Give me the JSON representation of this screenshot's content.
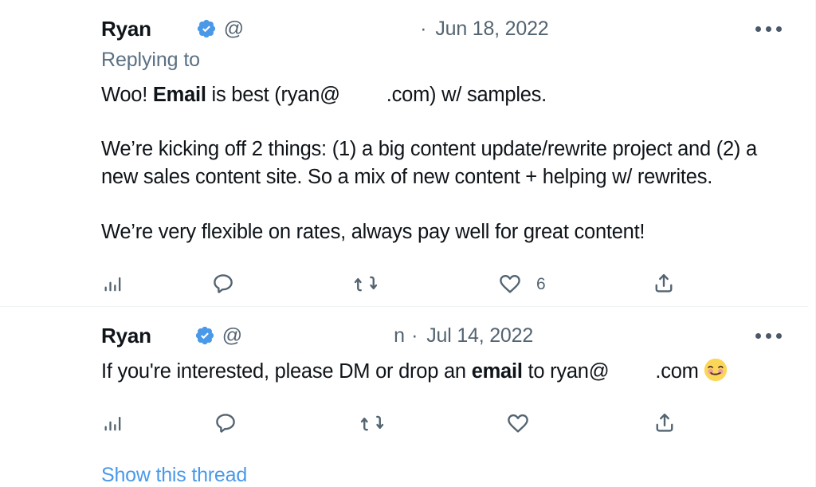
{
  "theme": {
    "background": "#ffffff",
    "text_primary": "#0f1419",
    "text_secondary": "#536471",
    "link": "#4a99e9",
    "verified_blue": "#4a99e9",
    "divider": "#eef3f4"
  },
  "tweets": [
    {
      "display_name": "Ryan",
      "verified_icon": "verified-badge-icon",
      "handle": "@",
      "separator": "·",
      "date": "Jun 18, 2022",
      "more_icon": "more-horizontal-icon",
      "replying_to": "Replying to",
      "body": {
        "line1_a": "Woo! ",
        "line1_bold": "Email",
        "line1_b": " is best (ryan@",
        "line1_c": ".com) w/ samples.",
        "para2": "We’re kicking off 2 things: (1) a big content update/rewrite project and (2) a new sales content site. So a mix of new content + helping w/ rewrites.",
        "para3": "We’re very flexible on rates, always pay well for great content!"
      },
      "actions": {
        "analytics": {
          "icon": "analytics-bar-icon",
          "label": "View Tweet analytics",
          "count": ""
        },
        "reply": {
          "icon": "reply-bubble-icon",
          "label": "Reply",
          "count": ""
        },
        "retweet": {
          "icon": "retweet-icon",
          "label": "Retweet",
          "count": ""
        },
        "like": {
          "icon": "heart-icon",
          "label": "Like",
          "count": "6"
        },
        "share": {
          "icon": "share-upload-icon",
          "label": "Share Tweet",
          "count": ""
        }
      }
    },
    {
      "display_name": "Ryan",
      "verified_icon": "verified-badge-icon",
      "handle": "@",
      "handle_tail": "n",
      "separator": "·",
      "date": "Jul 14, 2022",
      "more_icon": "more-horizontal-icon",
      "body": {
        "line1_a": "If you're interested, please DM or drop an ",
        "line1_bold": "email",
        "line1_b": " to ryan@",
        "line1_c": ".com",
        "emoji": "smiling-face-with-smiling-eyes"
      },
      "actions": {
        "analytics": {
          "icon": "analytics-bar-icon",
          "label": "View Tweet analytics",
          "count": ""
        },
        "reply": {
          "icon": "reply-bubble-icon",
          "label": "Reply",
          "count": ""
        },
        "retweet": {
          "icon": "retweet-icon",
          "label": "Retweet",
          "count": ""
        },
        "like": {
          "icon": "heart-icon",
          "label": "Like",
          "count": ""
        },
        "share": {
          "icon": "share-upload-icon",
          "label": "Share Tweet",
          "count": ""
        }
      },
      "show_thread": "Show this thread"
    }
  ]
}
